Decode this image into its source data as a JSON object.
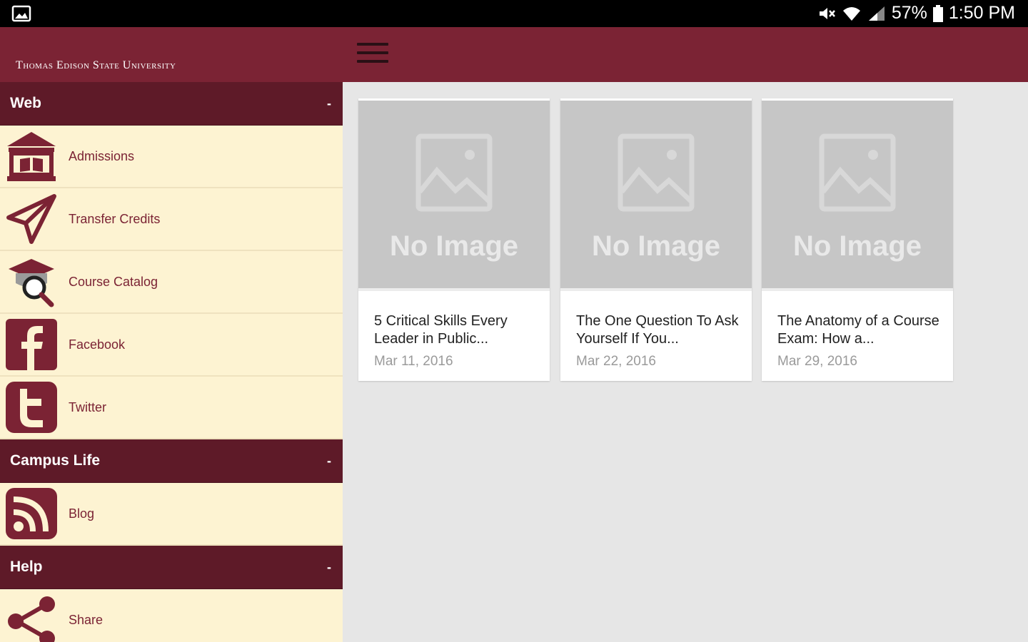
{
  "status_bar": {
    "battery": "57%",
    "time": "1:50 PM",
    "icons": [
      "image-icon",
      "mute-icon",
      "wifi-icon",
      "signal-icon",
      "battery-icon"
    ]
  },
  "app_bar": {
    "logo_text": "Thomas Edison State University",
    "menu_icon": "hamburger-icon",
    "color": "#7b2334"
  },
  "drawer": {
    "sections": [
      {
        "title": "Web",
        "toggle": "-"
      },
      {
        "title": "Campus Life",
        "toggle": "-"
      },
      {
        "title": "Help",
        "toggle": "-"
      }
    ],
    "web_items": [
      {
        "label": "Admissions",
        "icon": "building-icon"
      },
      {
        "label": "Transfer Credits",
        "icon": "paper-plane-icon"
      },
      {
        "label": "Course Catalog",
        "icon": "graduation-search-icon"
      },
      {
        "label": "Facebook",
        "icon": "facebook-icon"
      },
      {
        "label": "Twitter",
        "icon": "twitter-icon"
      }
    ],
    "campus_items": [
      {
        "label": "Blog",
        "icon": "rss-icon"
      }
    ],
    "help_items": [
      {
        "label": "Share",
        "icon": "share-icon"
      }
    ]
  },
  "cards": [
    {
      "placeholder": "No Image",
      "title": "5 Critical Skills Every Leader in Public...",
      "date": "Mar 11, 2016"
    },
    {
      "placeholder": "No Image",
      "title": "The One Question To Ask Yourself If You...",
      "date": "Mar 22, 2016"
    },
    {
      "placeholder": "No Image",
      "title": "The Anatomy of a Course Exam: How a...",
      "date": "Mar 29, 2016"
    }
  ]
}
